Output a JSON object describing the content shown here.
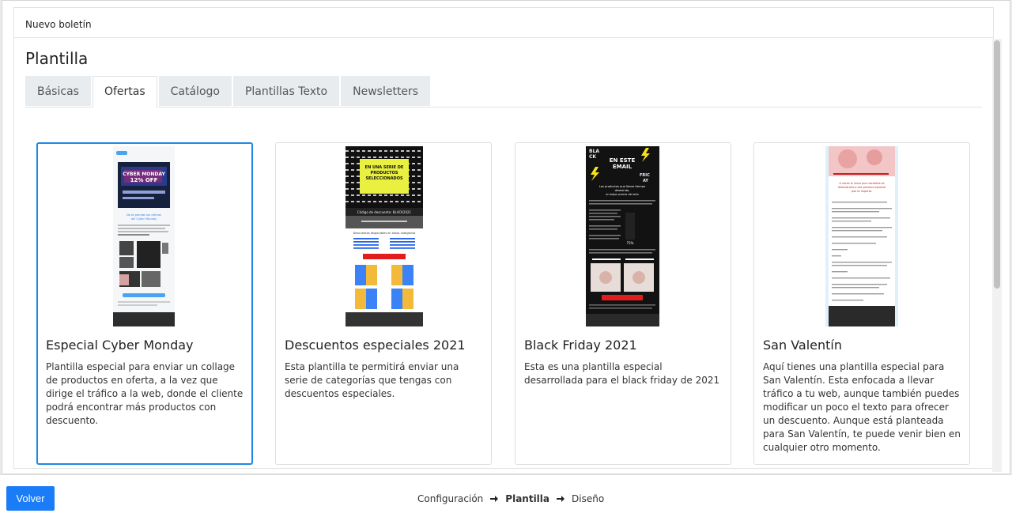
{
  "modal": {
    "title": "Nuevo boletín",
    "heading": "Plantilla"
  },
  "tabs": [
    {
      "label": "Básicas",
      "active": false
    },
    {
      "label": "Ofertas",
      "active": true
    },
    {
      "label": "Catálogo",
      "active": false
    },
    {
      "label": "Plantillas Texto",
      "active": false
    },
    {
      "label": "Newsletters",
      "active": false
    }
  ],
  "templates": [
    {
      "title": "Especial Cyber Monday",
      "description": "Plantilla especial para enviar un collage de productos en oferta, a la vez que dirige el tráfico a la web, donde el cliente podrá encontrar más productos con descuento.",
      "selected": true,
      "thumb": {
        "headline": "CYBER MONDAY 12% OFF",
        "tagline": "No te pierdas las ofertas del Cyber Monday"
      }
    },
    {
      "title": "Descuentos especiales 2021",
      "description": "Esta plantilla te permitirá enviar una serie de categorías que tengas con descuentos especiales.",
      "selected": false,
      "thumb": {
        "headline": "EN UNA SERIE DE PRODUCTOS SELECCIONADOS",
        "code": "Código de descuento: BLACK2021",
        "sub": "Descuentos disponibles en estas categorías"
      }
    },
    {
      "title": "Black Friday 2021",
      "description": "Esta es una plantilla especial desarrollada para el black friday de 2021",
      "selected": false,
      "thumb": {
        "headline": "EN ESTE EMAIL",
        "sub": "Los productos que llevas tiempo deseando, al mejor precio del año"
      }
    },
    {
      "title": "San Valentín",
      "description": "Aquí tienes una plantilla especial para San Valentín. Esta enfocada a llevar tráfico a tu web, aunque también puedes modificar un poco el texto para ofrecer un descuento. Aunque está planteada para San Valentín, te puede venir bien en cualquier otro momento.",
      "selected": false,
      "thumb": {
        "headline": "A veces lo único que necesitas es demostrarle a esa persona especial que te importa."
      }
    }
  ],
  "footer": {
    "back_label": "Volver",
    "steps": [
      {
        "label": "Configuración",
        "active": false
      },
      {
        "label": "Plantilla",
        "active": true
      },
      {
        "label": "Diseño",
        "active": false
      }
    ]
  },
  "colors": {
    "accent": "#1a7cf6",
    "selected_border": "#1e88e5"
  }
}
